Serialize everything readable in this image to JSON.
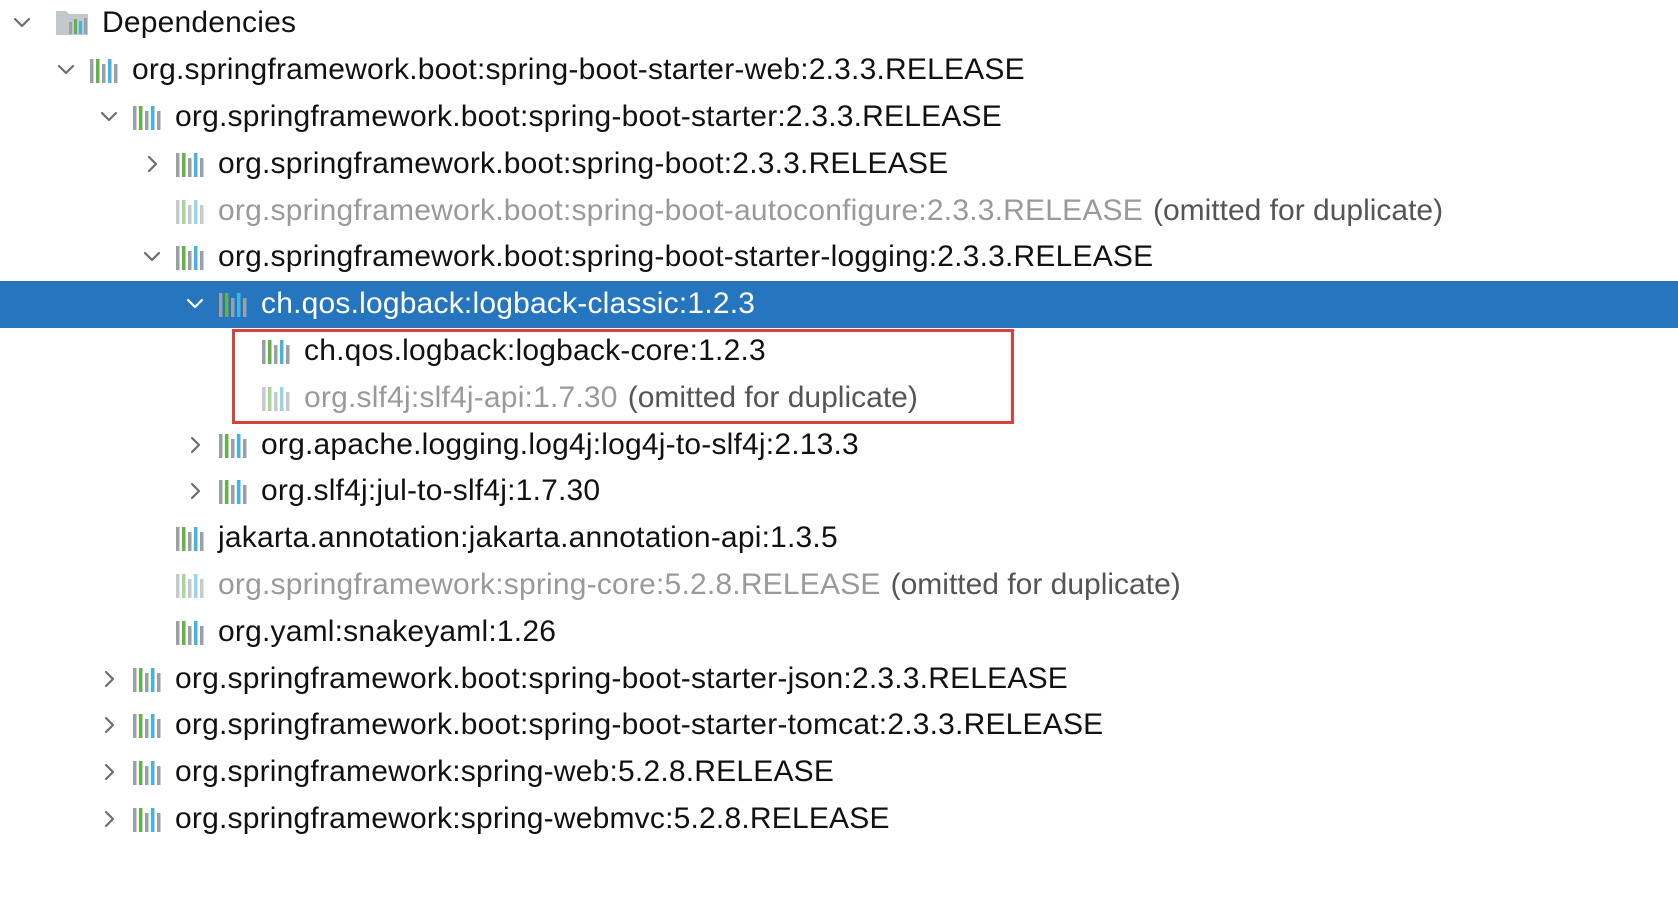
{
  "root": {
    "label": "Dependencies",
    "icon": "dependencies-folder-icon",
    "expanded": true
  },
  "rows": [
    {
      "id": "row-1",
      "depth": 1,
      "toggle": "expanded",
      "label": "org.springframework.boot:spring-boot-starter-web:2.3.3.RELEASE",
      "suffix": "",
      "omitted": false
    },
    {
      "id": "row-2",
      "depth": 2,
      "toggle": "expanded",
      "label": "org.springframework.boot:spring-boot-starter:2.3.3.RELEASE",
      "suffix": "",
      "omitted": false
    },
    {
      "id": "row-3",
      "depth": 3,
      "toggle": "collapsed",
      "label": "org.springframework.boot:spring-boot:2.3.3.RELEASE",
      "suffix": "",
      "omitted": false
    },
    {
      "id": "row-4",
      "depth": 3,
      "toggle": "none",
      "label": "org.springframework.boot:spring-boot-autoconfigure:2.3.3.RELEASE",
      "suffix": "(omitted for duplicate)",
      "omitted": true
    },
    {
      "id": "row-5",
      "depth": 3,
      "toggle": "expanded",
      "label": "org.springframework.boot:spring-boot-starter-logging:2.3.3.RELEASE",
      "suffix": "",
      "omitted": false
    },
    {
      "id": "row-6",
      "depth": 4,
      "toggle": "expanded",
      "label": "ch.qos.logback:logback-classic:1.2.3",
      "suffix": "",
      "omitted": false,
      "selected": true
    },
    {
      "id": "row-7",
      "depth": 5,
      "toggle": "none",
      "label": "ch.qos.logback:logback-core:1.2.3",
      "suffix": "",
      "omitted": false
    },
    {
      "id": "row-8",
      "depth": 5,
      "toggle": "none",
      "label": "org.slf4j:slf4j-api:1.7.30",
      "suffix": "(omitted for duplicate)",
      "omitted": true
    },
    {
      "id": "row-9",
      "depth": 4,
      "toggle": "collapsed",
      "label": "org.apache.logging.log4j:log4j-to-slf4j:2.13.3",
      "suffix": "",
      "omitted": false
    },
    {
      "id": "row-10",
      "depth": 4,
      "toggle": "collapsed",
      "label": "org.slf4j:jul-to-slf4j:1.7.30",
      "suffix": "",
      "omitted": false
    },
    {
      "id": "row-11",
      "depth": 3,
      "toggle": "none",
      "label": "jakarta.annotation:jakarta.annotation-api:1.3.5",
      "suffix": "",
      "omitted": false
    },
    {
      "id": "row-12",
      "depth": 3,
      "toggle": "none",
      "label": "org.springframework:spring-core:5.2.8.RELEASE",
      "suffix": "(omitted for duplicate)",
      "omitted": true
    },
    {
      "id": "row-13",
      "depth": 3,
      "toggle": "none",
      "label": "org.yaml:snakeyaml:1.26",
      "suffix": "",
      "omitted": false
    },
    {
      "id": "row-14",
      "depth": 2,
      "toggle": "collapsed",
      "label": "org.springframework.boot:spring-boot-starter-json:2.3.3.RELEASE",
      "suffix": "",
      "omitted": false
    },
    {
      "id": "row-15",
      "depth": 2,
      "toggle": "collapsed",
      "label": "org.springframework.boot:spring-boot-starter-tomcat:2.3.3.RELEASE",
      "suffix": "",
      "omitted": false
    },
    {
      "id": "row-16",
      "depth": 2,
      "toggle": "collapsed",
      "label": "org.springframework:spring-web:5.2.8.RELEASE",
      "suffix": "",
      "omitted": false
    },
    {
      "id": "row-17",
      "depth": 2,
      "toggle": "collapsed",
      "label": "org.springframework:spring-webmvc:5.2.8.RELEASE",
      "suffix": "",
      "omitted": false
    }
  ],
  "colors": {
    "selection": "#2675bf",
    "highlight_border": "#d9423a",
    "omitted_text": "#9a9a9a",
    "library_bar_gray": "#9aa0a6",
    "library_bar_green": "#62b543",
    "library_bar_blue": "#40b6e0"
  }
}
